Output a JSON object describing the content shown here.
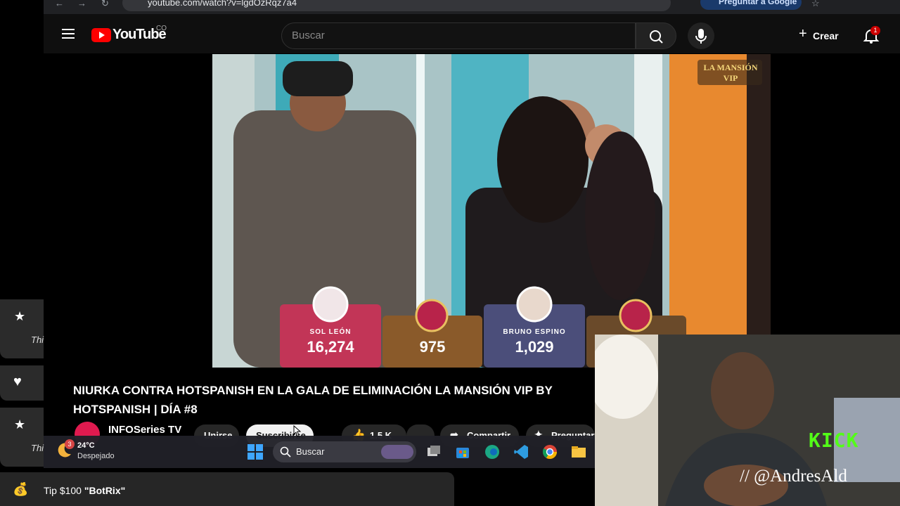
{
  "browser": {
    "address": "youtube.com/watch?v=lgdOzRqz7a4",
    "ask_google": "Preguntar a Google"
  },
  "header": {
    "logo_text": "YouTube",
    "country": "CO",
    "search_placeholder": "Buscar",
    "create_label": "Crear",
    "notification_count": "1"
  },
  "video": {
    "overlay_brand": "LA MANSIÓN VIP",
    "scoreboard": [
      {
        "name": "SOL LEÓN",
        "votes": "16,274"
      },
      {
        "name": "",
        "votes": "975"
      },
      {
        "name": "BRUNO ESPINO",
        "votes": "1,029"
      },
      {
        "name": "",
        "votes": ""
      }
    ],
    "title": "NIURKA CONTRA HOTSPANISH EN LA GALA DE ELIMINACIÓN LA MANSIÓN VIP BY HOTSPANISH | DÍA #8",
    "channel": "INFOSeries TV",
    "join_label": "Unirse",
    "subscribe_label": "Suscribirse",
    "likes": "1.5 K",
    "share_label": "Compartir",
    "ask_label": "Preguntar"
  },
  "taskbar": {
    "weather_badge": "3",
    "temperature": "24°C",
    "condition": "Despejado",
    "search_label": "Buscar"
  },
  "overlay": {
    "side_cards": [
      {
        "icon": "star-icon",
        "text": "Thi"
      },
      {
        "icon": "heart-icon",
        "text": ""
      },
      {
        "icon": "star-icon",
        "text": "Thi"
      }
    ],
    "tip_text_prefix": "Tip $100 ",
    "tip_text_name": "\"BotRix\"",
    "kick_label": "KICK",
    "streamer_handle": "// @AndresAld"
  },
  "colors": {
    "accent_red": "#ff0000",
    "kick_green": "#53fc18"
  }
}
